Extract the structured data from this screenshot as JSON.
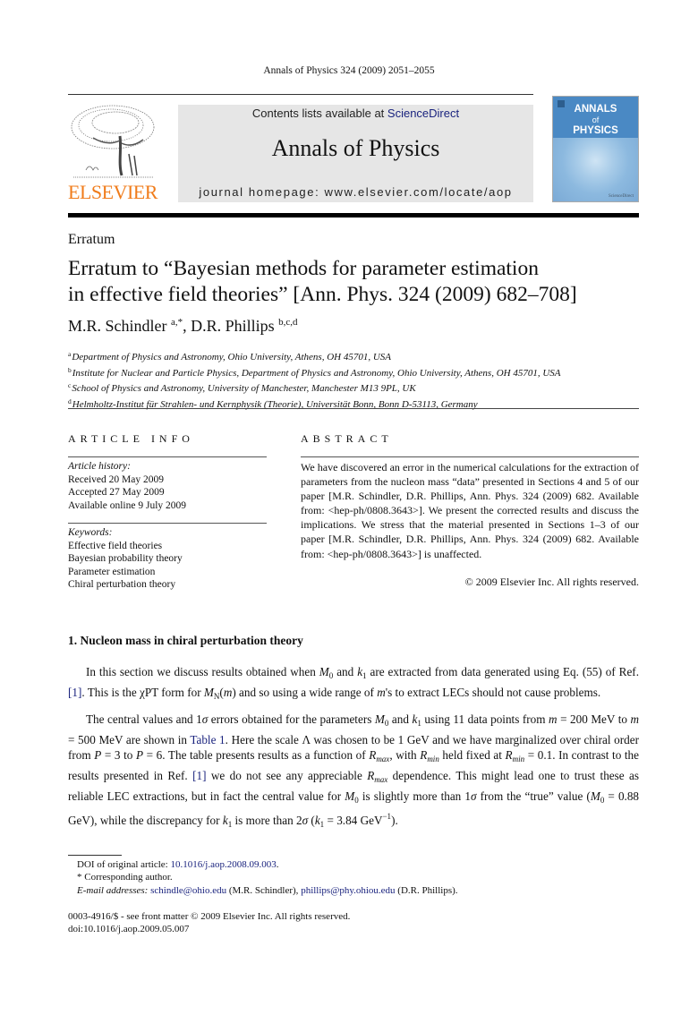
{
  "header": {
    "citation": "Annals of Physics 324 (2009) 2051–2055",
    "publisher_logo_text": "ELSEVIER",
    "contents_prefix": "Contents lists available at ",
    "contents_link": "ScienceDirect",
    "journal_name": "Annals of Physics",
    "homepage": "journal homepage: www.elsevier.com/locate/aop",
    "cover": {
      "line1": "ANNALS",
      "line2": "of",
      "line3": "PHYSICS",
      "publisher_mark": "ScienceDirect"
    },
    "colors": {
      "elsevier_orange": "#f07c1b",
      "link_blue": "#1a237e",
      "cover_blue": "#4a89c4",
      "masthead_gray": "#e6e6e6"
    }
  },
  "article": {
    "type": "Erratum",
    "title_line1": "Erratum to “Bayesian methods for parameter estimation",
    "title_line2": "in effective field theories” [Ann. Phys. 324 (2009) 682–708]",
    "authors": [
      {
        "name": "M.R. Schindler",
        "marks": "a,*"
      },
      {
        "name": "D.R. Phillips",
        "marks": "b,c,d"
      }
    ],
    "author_separator": ", ",
    "affiliations": [
      {
        "mark": "a",
        "text": "Department of Physics and Astronomy, Ohio University, Athens, OH 45701, USA"
      },
      {
        "mark": "b",
        "text": "Institute for Nuclear and Particle Physics, Department of Physics and Astronomy, Ohio University, Athens, OH 45701, USA"
      },
      {
        "mark": "c",
        "text": "School of Physics and Astronomy, University of Manchester, Manchester M13 9PL, UK"
      },
      {
        "mark": "d",
        "text": "Helmholtz-Institut für Strahlen- und Kernphysik (Theorie), Universität Bonn, Bonn D-53113, Germany"
      }
    ]
  },
  "article_info": {
    "heading": "ARTICLE INFO",
    "history_label": "Article history:",
    "history": [
      "Received 20 May 2009",
      "Accepted 27 May 2009",
      "Available online 9 July 2009"
    ],
    "keywords_label": "Keywords:",
    "keywords": [
      "Effective field theories",
      "Bayesian probability theory",
      "Parameter estimation",
      "Chiral perturbation theory"
    ]
  },
  "abstract": {
    "heading": "ABSTRACT",
    "body": "We have discovered an error in the numerical calculations for the extraction of parameters from the nucleon mass “data” presented in Sections 4 and 5 of our paper [M.R. Schindler, D.R. Phillips, Ann. Phys. 324 (2009) 682. Available from: <hep-ph/0808.3643>]. We present the corrected results and discuss the implications. We stress that the material presented in Sections 1–3 of our paper [M.R. Schindler, D.R. Phillips, Ann. Phys. 324 (2009) 682. Available from: <hep-ph/0808.3643>] is unaffected.",
    "copyright": "© 2009 Elsevier Inc. All rights reserved."
  },
  "section1": {
    "heading": "1. Nucleon mass in chiral perturbation theory",
    "p1": {
      "t1": "In this section we discuss results obtained when ",
      "M0": "M",
      "sub0": "0",
      "t2": " and ",
      "k1": "k",
      "sub1": "1",
      "t3": " are extracted from data generated using Eq. (55) of Ref. ",
      "ref1": "[1]",
      "t4": ". This is the χPT form for ",
      "MN": "M",
      "subN": "N",
      "t5": "(",
      "m": "m",
      "t6": ") and so using a wide range of ",
      "m2": "m",
      "t7": "'s to extract LECs should not cause problems."
    },
    "p2": {
      "t1": "The central values and 1",
      "sigma": "σ",
      "t2": " errors obtained for the parameters ",
      "t3": " using 11 data points from ",
      "m": "m",
      "t4": " = 200 MeV to ",
      "t5": " = 500 MeV are shown in ",
      "table_ref": "Table 1",
      "t6": ". Here the scale Λ was chosen to be 1 GeV and we have marginalized over chiral order from ",
      "P": "P",
      "t7": " = 3 to ",
      "t8": " = 6. The table presents results as a function of ",
      "R": "R",
      "max": "max",
      "min": "min",
      "t9": ", with ",
      "t10": " held fixed at ",
      "t11": " = 0.1. In contrast to the results presented in Ref. ",
      "ref1": "[1]",
      "t12": " we do not see any appreciable ",
      "t13": " dependence. This might lead one to trust these as reliable LEC extractions, but in fact the central value for ",
      "t14": " is slightly more than 1",
      "t15": " from the “true” value (",
      "t16": " = 0.88 GeV), while the discrepancy for ",
      "t17": " is more than 2",
      "t18": " (",
      "t19": " = 3.84 GeV",
      "exp": "−1",
      "t20": ")."
    }
  },
  "footnotes": {
    "doi_label": "DOI of original article: ",
    "doi_link": "10.1016/j.aop.2008.09.003",
    "doi_end": ".",
    "corresponding": "* Corresponding author.",
    "email_label": "E-mail addresses: ",
    "email1": "schindle@ohio.edu",
    "email1_who": " (M.R. Schindler), ",
    "email2": "phillips@phy.ohiou.edu",
    "email2_who": " (D.R. Phillips)."
  },
  "front_matter": {
    "line1": "0003-4916/$ - see front matter © 2009 Elsevier Inc. All rights reserved.",
    "line2": "doi:10.1016/j.aop.2009.05.007"
  }
}
